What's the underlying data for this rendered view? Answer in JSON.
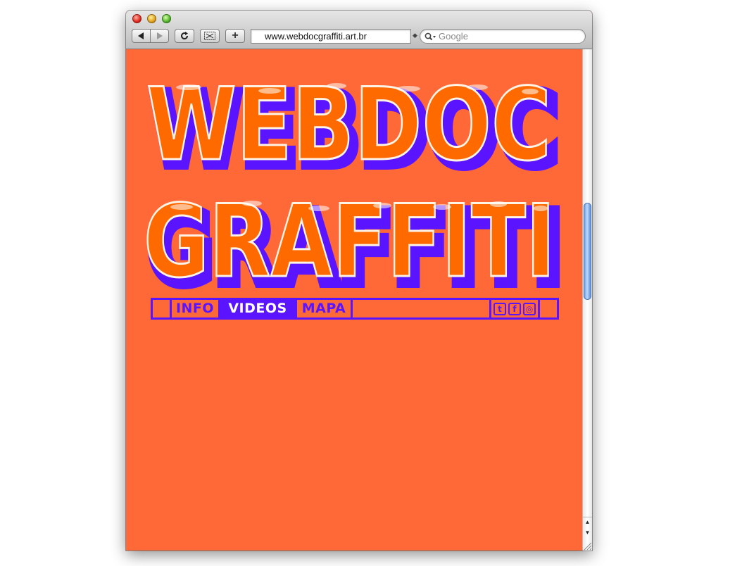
{
  "browser": {
    "url": "www.webdocgraffiti.art.br",
    "search_placeholder": "Google",
    "buttons": {
      "back": "back-arrow",
      "forward": "forward-arrow",
      "reload": "reload-icon",
      "snippet": "snippet-icon",
      "add_bookmark": "+"
    }
  },
  "page": {
    "background_color": "#ff6837",
    "logo": {
      "text": "WEBDOC GRAFFITI",
      "fill_color": "#ff6a00",
      "outline_color": "#5a14ff"
    },
    "nav": {
      "info": "INFO",
      "videos": "VIDEOS",
      "mapa": "MAPA",
      "social": [
        {
          "icon": "twitter-icon",
          "glyph": "t"
        },
        {
          "icon": "facebook-icon",
          "glyph": "f"
        },
        {
          "icon": "instagram-icon",
          "glyph": "◎"
        }
      ]
    }
  }
}
